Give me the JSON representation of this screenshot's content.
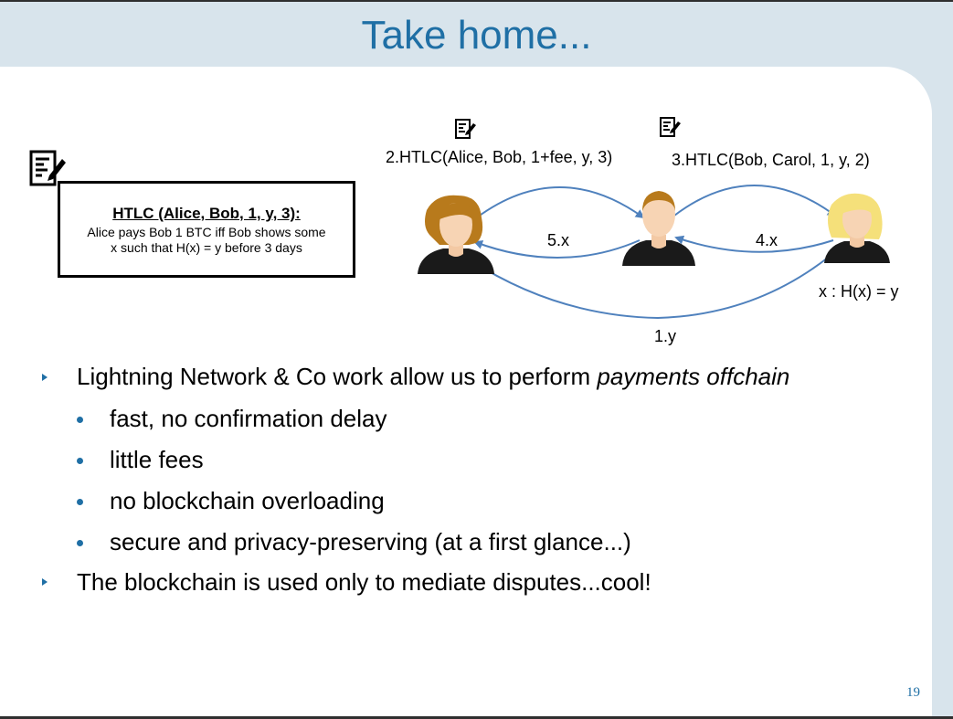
{
  "slide": {
    "title": "Take home...",
    "page_number": "19"
  },
  "htlc_box": {
    "title": "HTLC (Alice, Bob, 1, y, 3):",
    "body_line1": "Alice pays Bob 1 BTC iff Bob shows some",
    "body_line2": "x such that H(x) = y before 3 days",
    "icon": "contract-icon"
  },
  "diagram": {
    "htlc_alice_bob": "2.HTLC(Alice, Bob, 1+fee, y, 3)",
    "htlc_bob_carol": "3.HTLC(Bob, Carol, 1, y, 2)",
    "reveal_bob_alice": "5.x",
    "reveal_carol_bob": "4.x",
    "secret_carol": "x : H(x) = y",
    "hash_carol_alice": "1.y",
    "people": [
      "Alice",
      "Bob",
      "Carol"
    ],
    "icons": [
      "contract-icon",
      "contract-icon"
    ],
    "colors": {
      "arrow": "#4f81bd"
    }
  },
  "bullets": [
    {
      "level": 1,
      "text": "Lightning Network & Co work allow us to perform ",
      "emphasis": "payments offchain"
    },
    {
      "level": 2,
      "text": "fast, no confirmation delay"
    },
    {
      "level": 2,
      "text": "little fees"
    },
    {
      "level": 2,
      "text": "no blockchain overloading"
    },
    {
      "level": 2,
      "text": "secure and privacy-preserving (at a first glance...)"
    },
    {
      "level": 1,
      "text": "The blockchain is used only to mediate disputes...cool!"
    }
  ],
  "colors": {
    "title": "#1f6fa5",
    "bullet_marker": "#1f6fa5",
    "frame": "#d8e4ec"
  }
}
